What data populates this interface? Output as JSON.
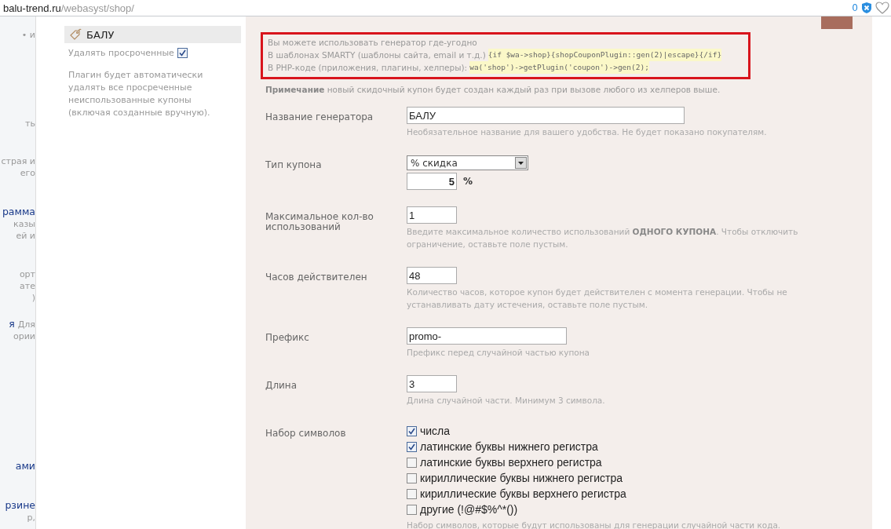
{
  "browser": {
    "url_host": "balu-trend.ru",
    "url_path": "/webasyst/shop/",
    "counter": "0"
  },
  "left_fragments": [
    [
      {
        "text": "• и",
        "kind": "text"
      }
    ],
    [
      {
        "text": "ть",
        "kind": "text"
      }
    ],
    [
      {
        "text": "страя и",
        "kind": "text"
      }
    ],
    [
      {
        "text": "его",
        "kind": "text"
      }
    ],
    [
      {
        "text": "рамма",
        "kind": "link"
      }
    ],
    [
      {
        "text": "казы",
        "kind": "text"
      }
    ],
    [
      {
        "text": "ей и",
        "kind": "text"
      }
    ],
    [
      {
        "text": "орт",
        "kind": "text"
      }
    ],
    [
      {
        "text": "ате",
        "kind": "text"
      }
    ],
    [
      {
        "text": ")",
        "kind": "text"
      }
    ],
    [
      {
        "text": "я",
        "kind": "link"
      },
      {
        "text": "Для",
        "kind": "text"
      }
    ],
    [
      {
        "text": "ории",
        "kind": "text"
      }
    ],
    [
      {
        "text": "ами",
        "kind": "link"
      }
    ],
    [
      {
        "text": "рзине",
        "kind": "link"
      }
    ],
    [
      {
        "text": "р,",
        "kind": "text"
      }
    ]
  ],
  "sidebar": {
    "item": {
      "label": "БАЛУ",
      "selected": true
    },
    "delete_expired": {
      "label": "Удалять просроченные",
      "checked": true
    },
    "note": "Плагин будет автоматически удалять все просреченные неиспользованные купоны (включая созданные вручную)."
  },
  "main": {
    "usage": [
      [
        {
          "text": "Вы можете использовать генератор где-угодно",
          "kind": "text"
        }
      ],
      [
        {
          "text": "В шаблонах SMARTY (шаблоны сайта, email и т.д.)",
          "kind": "text"
        },
        {
          "text": "{if $wa->shop}{shopCouponPlugin::gen(2)|escape}{/if}",
          "kind": "code"
        }
      ],
      [
        {
          "text": "В PHP-коде (приложения, плагины, хелперы):",
          "kind": "text"
        },
        {
          "text": "wa('shop')->getPlugin('coupon')->gen(2);",
          "kind": "code"
        }
      ]
    ],
    "note": "**Примечание** новый скидочный купон будет создан каждый раз при вызове любого из хелперов выше.",
    "fields": [
      {
        "kind": "text",
        "label": "Название генератора",
        "value": "БАЛУ",
        "hint": "Необязательное название для вашего удобства. Не будет показано покупателям."
      },
      {
        "kind": "select",
        "label": "Тип купона",
        "value": "% скидка",
        "amount": "5",
        "unit": "%"
      },
      {
        "kind": "text",
        "label": "Максимальное кол-во использований",
        "value": "1",
        "hint": "Введите максимальное количество использований **ОДНОГО КУПОНА**. Чтобы отключить ограничение, оставьте поле пустым."
      },
      {
        "kind": "text",
        "label": "Часов действителен",
        "value": "48",
        "hint": "Количество часов, которое купон будет действителен с момента генерации. Чтобы не устанавливать дату истечения, оставьте поле пустым."
      },
      {
        "kind": "text",
        "label": "Префикс",
        "value": "promo-",
        "hint": "Префикс перед случайной частью купона"
      },
      {
        "kind": "text",
        "label": "Длина",
        "value": "3",
        "hint": "Длина случайной части. Минимум 3 символа."
      },
      {
        "kind": "checkboxes",
        "label": "Набор символов",
        "hint": "Набор символов, которые будут использованы для генерации случайной части кода.",
        "options": [
          {
            "label": "числа",
            "checked": true
          },
          {
            "label": "латинские буквы нижнего регистра",
            "checked": true
          },
          {
            "label": "латинские буквы верхнего регистра",
            "checked": false
          },
          {
            "label": "кириллические буквы нижнего регистра",
            "checked": false
          },
          {
            "label": "кириллические буквы верхнего регистра",
            "checked": false
          },
          {
            "label": "другие (!@#$%^*())",
            "checked": false
          }
        ]
      }
    ]
  }
}
